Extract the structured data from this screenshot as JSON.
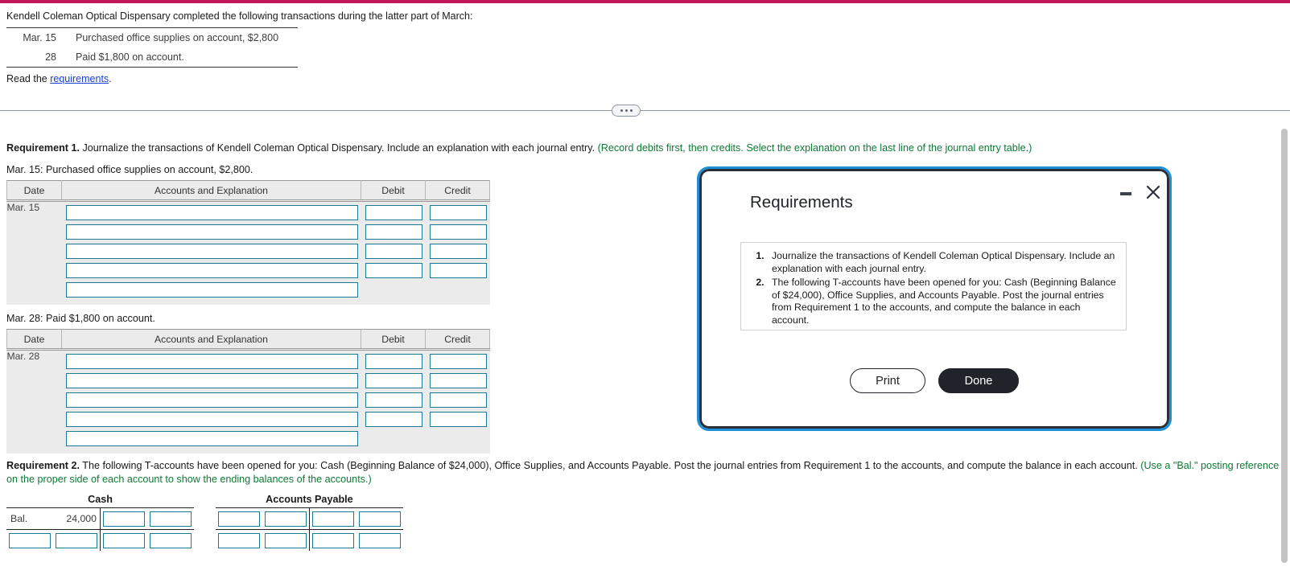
{
  "theme": {
    "accent_bar": "#c2185b",
    "input_border": "#1a7a96",
    "hint_green": "#0f7a34",
    "link_blue": "#1a3fd4",
    "modal_border": "#2b2f38",
    "modal_focus_ring": "#1f8fd6"
  },
  "problem": {
    "intro": "Kendell Coleman Optical Dispensary completed the following transactions during the latter part of March:",
    "transactions": [
      {
        "date": "Mar. 15",
        "description": "Purchased office supplies on account, $2,800"
      },
      {
        "date": "28",
        "description": "Paid $1,800 on account."
      }
    ],
    "read_prefix": "Read the ",
    "read_link": "requirements",
    "read_suffix": "."
  },
  "splitter": {
    "ellipsis": "•••"
  },
  "requirement1": {
    "label": "Requirement 1.",
    "text": " Journalize the transactions of Kendell Coleman Optical Dispensary. Include an explanation with each journal entry. ",
    "hint": "(Record debits first, then credits. Select the explanation on the last line of the journal entry table.)",
    "entries": [
      {
        "caption": "Mar. 15: Purchased office supplies on account, $2,800.",
        "date": "Mar. 15",
        "columns": [
          "Date",
          "Accounts and Explanation",
          "Debit",
          "Credit"
        ],
        "account_rows": 5,
        "amount_rows": 4
      },
      {
        "caption": "Mar. 28: Paid $1,800 on account.",
        "date": "Mar. 28",
        "columns": [
          "Date",
          "Accounts and Explanation",
          "Debit",
          "Credit"
        ],
        "account_rows": 5,
        "amount_rows": 4
      }
    ]
  },
  "requirement2": {
    "label": "Requirement 2.",
    "text": " The following T-accounts have been opened for you: Cash (Beginning Balance of $24,000), Office Supplies, and Accounts Payable. Post the journal entries from Requirement 1 to the accounts, and compute the balance in each account. ",
    "hint": "(Use a \"Bal.\" posting reference on the proper side of each account to show the ending balances of the accounts.)",
    "t_accounts": [
      {
        "title": "Cash",
        "rows": [
          {
            "left": [
              {
                "type": "text",
                "value": "Bal."
              },
              {
                "type": "num",
                "value": "24,000"
              }
            ],
            "right": [
              {
                "type": "input"
              },
              {
                "type": "input"
              }
            ]
          },
          {
            "left": [
              {
                "type": "input"
              },
              {
                "type": "input"
              }
            ],
            "right": [
              {
                "type": "input"
              },
              {
                "type": "input"
              }
            ]
          }
        ]
      },
      {
        "title": "Accounts Payable",
        "rows": [
          {
            "left": [
              {
                "type": "input"
              },
              {
                "type": "input"
              }
            ],
            "right": [
              {
                "type": "input"
              },
              {
                "type": "input"
              }
            ]
          },
          {
            "left": [
              {
                "type": "input"
              },
              {
                "type": "input"
              }
            ],
            "right": [
              {
                "type": "input"
              },
              {
                "type": "input"
              }
            ]
          }
        ]
      }
    ]
  },
  "modal": {
    "title": "Requirements",
    "items": [
      "Journalize the transactions of Kendell Coleman Optical Dispensary. Include an explanation with each journal entry.",
      "The following T-accounts have been opened for you: Cash (Beginning Balance of $24,000), Office Supplies, and Accounts Payable. Post the journal entries from Requirement 1 to the accounts, and compute the balance in each account."
    ],
    "print_label": "Print",
    "done_label": "Done",
    "minimize_icon": "minimize-icon",
    "close_icon": "close-icon"
  }
}
